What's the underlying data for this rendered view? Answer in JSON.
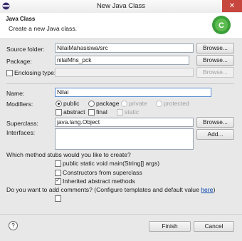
{
  "window": {
    "title": "New Java Class",
    "close_glyph": "✕"
  },
  "header": {
    "title": "Java Class",
    "description": "Create a new Java class."
  },
  "source_folder": {
    "label": "Source folder:",
    "value": "NilaiMahasiswa/src",
    "browse_label": "Browse..."
  },
  "package": {
    "label": "Package:",
    "value": "nilaiMhs_pck",
    "browse_label": "Browse..."
  },
  "enclosing": {
    "label": "Enclosing type:",
    "checked": false,
    "value": "",
    "browse_label": "Browse..."
  },
  "name": {
    "label": "Name:",
    "value": "Nilai"
  },
  "modifiers": {
    "label": "Modifiers:",
    "access": [
      {
        "label": "public",
        "selected": true,
        "enabled": true
      },
      {
        "label": "package",
        "selected": false,
        "enabled": true
      },
      {
        "label": "private",
        "selected": false,
        "enabled": false
      },
      {
        "label": "protected",
        "selected": false,
        "enabled": false
      }
    ],
    "flags": [
      {
        "label": "abstract",
        "checked": false,
        "enabled": true
      },
      {
        "label": "final",
        "checked": false,
        "enabled": true
      },
      {
        "label": "static",
        "checked": false,
        "enabled": false
      }
    ]
  },
  "superclass": {
    "label": "Superclass:",
    "value": "java.lang.Object",
    "browse_label": "Browse..."
  },
  "interfaces": {
    "label": "Interfaces:",
    "add_label": "Add..."
  },
  "stubs": {
    "question": "Which method stubs would you like to create?",
    "options": [
      {
        "label": "public static void main(String[] args)",
        "checked": false
      },
      {
        "label": "Constructors from superclass",
        "checked": false
      },
      {
        "label": "Inherited abstract methods",
        "checked": true
      }
    ]
  },
  "comments": {
    "prefix": "Do you want to add comments? (Configure templates and default value ",
    "link": "here",
    "suffix": ")"
  },
  "footer": {
    "help_glyph": "?",
    "finish_label": "Finish",
    "cancel_label": "Cancel"
  },
  "colors": {
    "close_button": "#c7463d",
    "logo": "#3c9f3a",
    "link": "#0645ad"
  }
}
